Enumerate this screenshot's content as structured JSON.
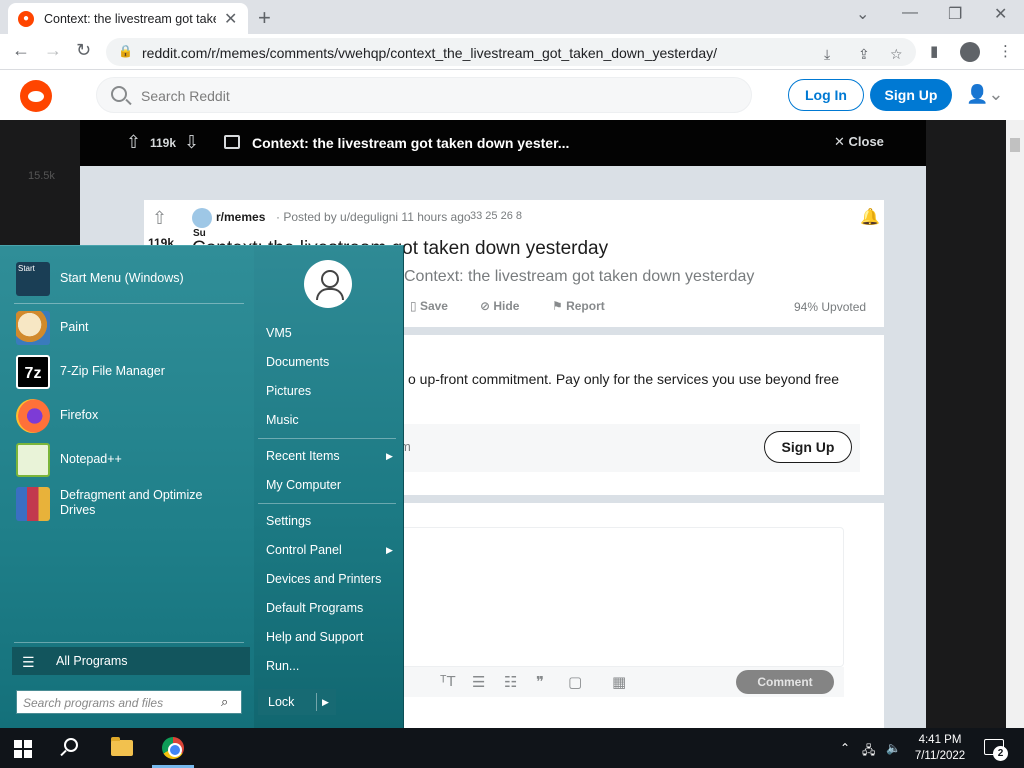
{
  "browser": {
    "tab_title": "Context: the livestream got taken",
    "url": "reddit.com/r/memes/comments/vwehqp/context_the_livestream_got_taken_down_yesterday/"
  },
  "reddit_header": {
    "search_placeholder": "Search Reddit",
    "login_label": "Log In",
    "signup_label": "Sign Up"
  },
  "post_bar": {
    "vote_count": "119k",
    "title": "Context: the livestream got taken down yester...",
    "close_label": "Close"
  },
  "post": {
    "vote_count": "119k",
    "subreddit": "r/memes",
    "posted_by": "· Posted by u/deguligni 11 hours ago",
    "awards_text": "33  25  26  8",
    "sub_short": "Su",
    "title": "Context: the livestream got taken down yesterday",
    "subtitle": "Context: the livestream got taken down yesterday",
    "actions": [
      "Save",
      "Hide",
      "Report"
    ],
    "upvoted": "94% Upvoted"
  },
  "ad": {
    "text": "o up-front commitment. Pay only for the services you use beyond free",
    "fragment": "m",
    "signup_label": "Sign Up"
  },
  "comment": {
    "button_label": "Comment"
  },
  "background_votes": "15.5k",
  "start_menu": {
    "pinned": [
      {
        "label": "Start Menu (Windows)",
        "icon": "start-menu-icon"
      },
      {
        "label": "Paint",
        "icon": "paint-icon"
      },
      {
        "label": "7-Zip File Manager",
        "icon": "7zip-icon"
      },
      {
        "label": "Firefox",
        "icon": "firefox-icon"
      },
      {
        "label": "Notepad++",
        "icon": "notepadpp-icon"
      },
      {
        "label": "Defragment and Optimize Drives",
        "icon": "defrag-icon"
      }
    ],
    "start_icon_text": "Start",
    "all_programs": "All Programs",
    "search_placeholder": "Search programs and files",
    "right_items": {
      "user": "VM5",
      "documents": "Documents",
      "pictures": "Pictures",
      "music": "Music",
      "recent_items": "Recent Items",
      "my_computer": "My Computer",
      "settings": "Settings",
      "control_panel": "Control Panel",
      "devices_printers": "Devices and Printers",
      "default_programs": "Default Programs",
      "help_support": "Help and Support",
      "run": "Run..."
    },
    "lock_label": "Lock"
  },
  "taskbar": {
    "time": "4:41 PM",
    "date": "7/11/2022",
    "notification_count": "2"
  },
  "colors": {
    "reddit_orange": "#ff4500",
    "reddit_blue": "#0079d3",
    "start_menu_teal": "#1f7f89"
  }
}
